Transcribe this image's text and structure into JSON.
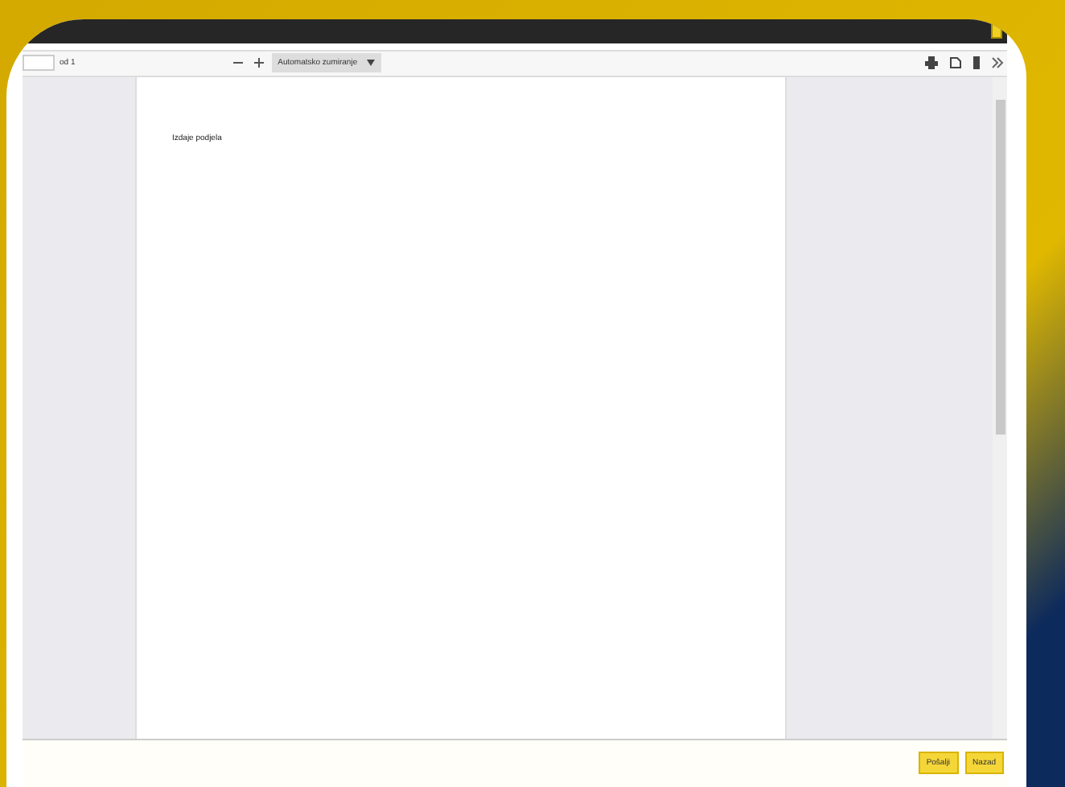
{
  "toolbar": {
    "page_count": "od 1",
    "zoom": "Automatsko zumiranje"
  },
  "document": {
    "text": "Izdaje podjela"
  },
  "buttons": [
    {
      "label": "Pošalji"
    },
    {
      "label": "Nazad"
    }
  ]
}
